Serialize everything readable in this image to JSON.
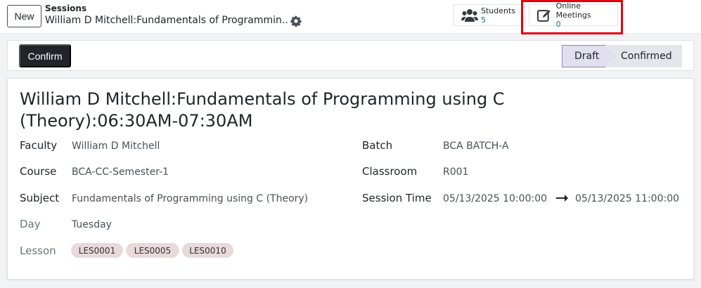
{
  "topbar": {
    "new_label": "New",
    "breadcrumb_parent": "Sessions",
    "breadcrumb_current": "William D Mitchell:Fundamentals of Programmin...",
    "gear_icon": "gear-icon",
    "students": {
      "label": "Students",
      "value": "5",
      "icon": "users-icon"
    },
    "meetings": {
      "label": "Online Meetings",
      "value": "0",
      "icon": "edit-square-icon"
    },
    "highlight_color": "#e3000f"
  },
  "statusbar": {
    "confirm_label": "Confirm",
    "stages": [
      {
        "label": "Draft",
        "active": true
      },
      {
        "label": "Confirmed",
        "active": false
      }
    ]
  },
  "record": {
    "title": "William D Mitchell:Fundamentals of Programming using C (Theory):06:30AM-07:30AM",
    "left_fields": [
      {
        "label": "Faculty",
        "value": "William D Mitchell"
      },
      {
        "label": "Course",
        "value": "BCA-CC-Semester-1"
      },
      {
        "label": "Subject",
        "value": "Fundamentals of Programming using C (Theory)"
      },
      {
        "label": "Day",
        "value": "Tuesday"
      },
      {
        "label": "Lesson"
      }
    ],
    "lessons": [
      "LES0001",
      "LES0005",
      "LES0010"
    ],
    "right_fields": [
      {
        "label": "Batch",
        "value": "BCA BATCH-A"
      },
      {
        "label": "Classroom",
        "value": "R001"
      },
      {
        "label": "Session Time",
        "start": "05/13/2025 10:00:00",
        "end": "05/13/2025 11:00:00"
      }
    ]
  }
}
